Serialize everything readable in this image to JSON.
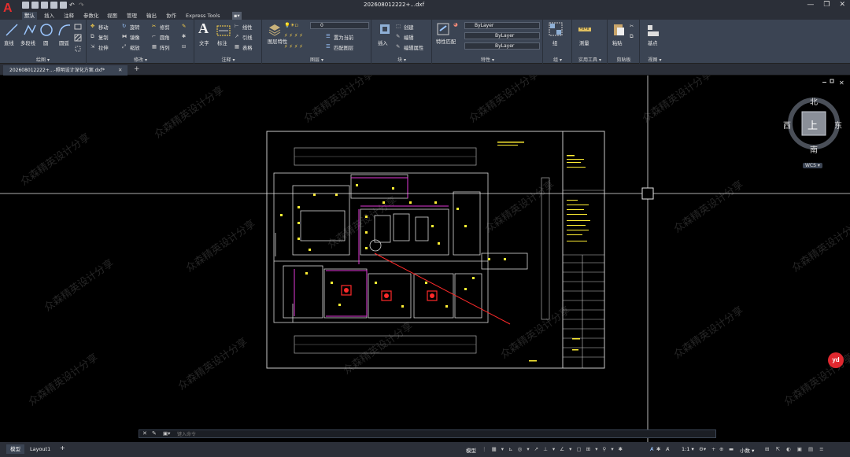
{
  "app": {
    "logo": "A",
    "title": "202608012222+...dxf"
  },
  "window_controls": {
    "minimize": "—",
    "restore": "❐",
    "close": "✕"
  },
  "menu_tabs": [
    "默认",
    "插入",
    "注释",
    "参数化",
    "视图",
    "管理",
    "输出",
    "协作",
    "Express Tools",
    "▪▾"
  ],
  "active_menu": "默认",
  "ribbon": {
    "draw": {
      "title": "绘图 ▾",
      "line": "直线",
      "polyline": "多段线",
      "circle": "圆",
      "arc": "圆弧"
    },
    "modify": {
      "title": "修改 ▾",
      "move": "移动",
      "rotate": "旋转",
      "trim": "修剪",
      "copy": "复制",
      "mirror": "镜像",
      "fillet": "圆角",
      "stretch": "拉伸",
      "scale": "缩放",
      "array": "阵列"
    },
    "annotation": {
      "title": "注释 ▾",
      "text": "文字",
      "dimension": "标注",
      "linear": "线性",
      "leader": "引线",
      "table": "表格"
    },
    "layers": {
      "title": "图层 ▾",
      "layer_props": "图层特性",
      "layer_value": "0",
      "set_current": "置为当前",
      "match_layer": "匹配图层"
    },
    "block": {
      "title": "块 ▾",
      "insert": "插入",
      "create": "创建",
      "edit": "编辑",
      "edit_attr": "编辑属性"
    },
    "properties": {
      "title": "特性 ▾",
      "match": "特性匹配",
      "color": "ByLayer",
      "linetype": "ByLayer",
      "lineweight": "ByLayer"
    },
    "groups": {
      "title": "组 ▾",
      "group": "组"
    },
    "utilities": {
      "title": "实用工具 ▾",
      "measure": "测量"
    },
    "clipboard": {
      "title": "剪贴板",
      "paste": "粘贴"
    },
    "view": {
      "title": "视图 ▾",
      "base": "基点"
    }
  },
  "file_tab": {
    "name": "202608012222+...-照明设计深化方案.dxf*",
    "close": "✕",
    "new": "+"
  },
  "viewcube": {
    "north": "北",
    "south": "南",
    "east": "东",
    "west": "西",
    "face": "上",
    "wcs": "WCS ▾"
  },
  "command": {
    "placeholder": "键入命令"
  },
  "layout_tabs": [
    "模型",
    "Layout1",
    "+"
  ],
  "status": {
    "model": "模型",
    "scale": "1:1 ▾",
    "units": "小数 ▾"
  },
  "badge": "yd",
  "watermark": "众森精英设计分享"
}
